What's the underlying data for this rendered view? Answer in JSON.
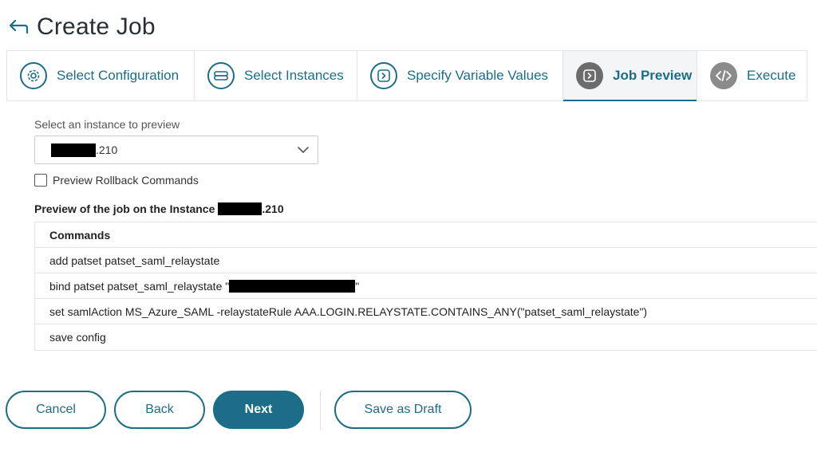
{
  "header": {
    "title": "Create Job",
    "back_icon": "back-arrow-icon"
  },
  "wizard": {
    "steps": [
      {
        "label": "Select Configuration",
        "icon": "gear-icon",
        "state": "done"
      },
      {
        "label": "Select Instances",
        "icon": "server-icon",
        "state": "done"
      },
      {
        "label": "Specify Variable Values",
        "icon": "chevron-right-icon",
        "state": "done"
      },
      {
        "label": "Job Preview",
        "icon": "chevron-right-icon",
        "state": "active"
      },
      {
        "label": "Execute",
        "icon": "code-icon",
        "state": "future"
      }
    ]
  },
  "instance_select": {
    "label": "Select an instance to preview",
    "value_suffix": ".210"
  },
  "rollback": {
    "label": "Preview Rollback Commands",
    "checked": false
  },
  "preview": {
    "title_prefix": "Preview of the job on the Instance",
    "title_suffix": ".210"
  },
  "commands": {
    "header": "Commands",
    "rows": [
      "add patset patset_saml_relaystate",
      "bind patset patset_saml_relaystate \"",
      "set samlAction MS_Azure_SAML -relaystateRule AAA.LOGIN.RELAYSTATE.CONTAINS_ANY(\"patset_saml_relaystate\")",
      "save config"
    ],
    "row2_suffix": "\""
  },
  "footer": {
    "cancel": "Cancel",
    "back": "Back",
    "next": "Next",
    "save_draft": "Save as Draft"
  },
  "colors": {
    "accent": "#1b6d88",
    "border": "#e2e5e8"
  }
}
